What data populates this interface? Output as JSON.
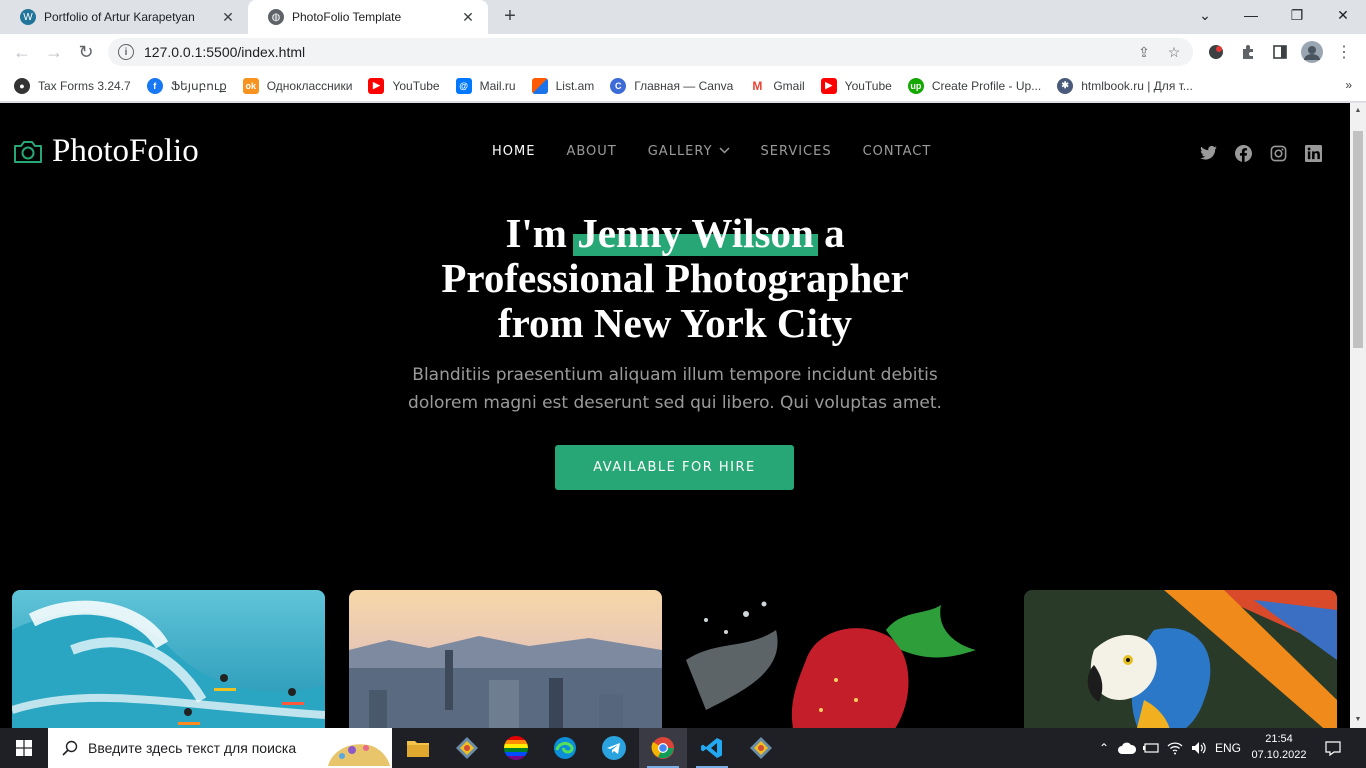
{
  "browser": {
    "tabs": [
      {
        "title": "Portfolio of Artur Karapetyan",
        "icon": "wordpress-icon",
        "active": false
      },
      {
        "title": "PhotoFolio Template",
        "icon": "globe-icon",
        "active": true
      }
    ],
    "url": "127.0.0.1:5500/index.html",
    "bookmarks": [
      {
        "label": "Tax Forms 3.24.7",
        "icon": "github-icon",
        "color": "#333333"
      },
      {
        "label": "Ֆեյսբուք",
        "icon": "facebook-icon",
        "color": "#1877f2"
      },
      {
        "label": "Одноклассники",
        "icon": "odnoklassniki-icon",
        "color": "#f7931e"
      },
      {
        "label": "YouTube",
        "icon": "youtube-icon",
        "color": "#ff0000"
      },
      {
        "label": "Mail.ru",
        "icon": "mailru-icon",
        "color": "#0078ff"
      },
      {
        "label": "List.am",
        "icon": "listam-icon",
        "color": "#ff5a00"
      },
      {
        "label": "Главная — Canva",
        "icon": "canva-icon",
        "color": "#3d6bd8"
      },
      {
        "label": "Gmail",
        "icon": "gmail-icon",
        "color": "#ea4335"
      },
      {
        "label": "YouTube",
        "icon": "youtube-icon",
        "color": "#ff0000"
      },
      {
        "label": "Create Profile - Up...",
        "icon": "upwork-icon",
        "color": "#14a800"
      },
      {
        "label": "htmlbook.ru | Для т...",
        "icon": "htmlbook-icon",
        "color": "#4a5a7a"
      }
    ]
  },
  "site": {
    "logo_text": "PhotoFolio",
    "nav": [
      {
        "label": "HOME",
        "active": true
      },
      {
        "label": "ABOUT",
        "active": false
      },
      {
        "label": "GALLERY",
        "active": false,
        "dropdown": true
      },
      {
        "label": "SERVICES",
        "active": false
      },
      {
        "label": "CONTACT",
        "active": false
      }
    ],
    "social": [
      "twitter-icon",
      "facebook-icon",
      "instagram-icon",
      "linkedin-icon"
    ],
    "hero": {
      "title_prefix": "I'm ",
      "title_name": "Jenny Wilson",
      "title_suffix": " a",
      "title_line2": "Professional Photographer",
      "title_line3": "from New York City",
      "subtitle": "Blanditiis praesentium aliquam illum tempore incidunt debitis dolorem magni est deserunt sed qui libero. Qui voluptas amet.",
      "cta": "AVAILABLE FOR HIRE"
    },
    "gallery": [
      "surfers-photo",
      "city-skyline-photo",
      "strawberry-photo",
      "parrot-photo"
    ],
    "accent_color": "#27a776"
  },
  "taskbar": {
    "search_placeholder": "Введите здесь текст для поиска",
    "language": "ENG",
    "time": "21:54",
    "date": "07.10.2022"
  }
}
